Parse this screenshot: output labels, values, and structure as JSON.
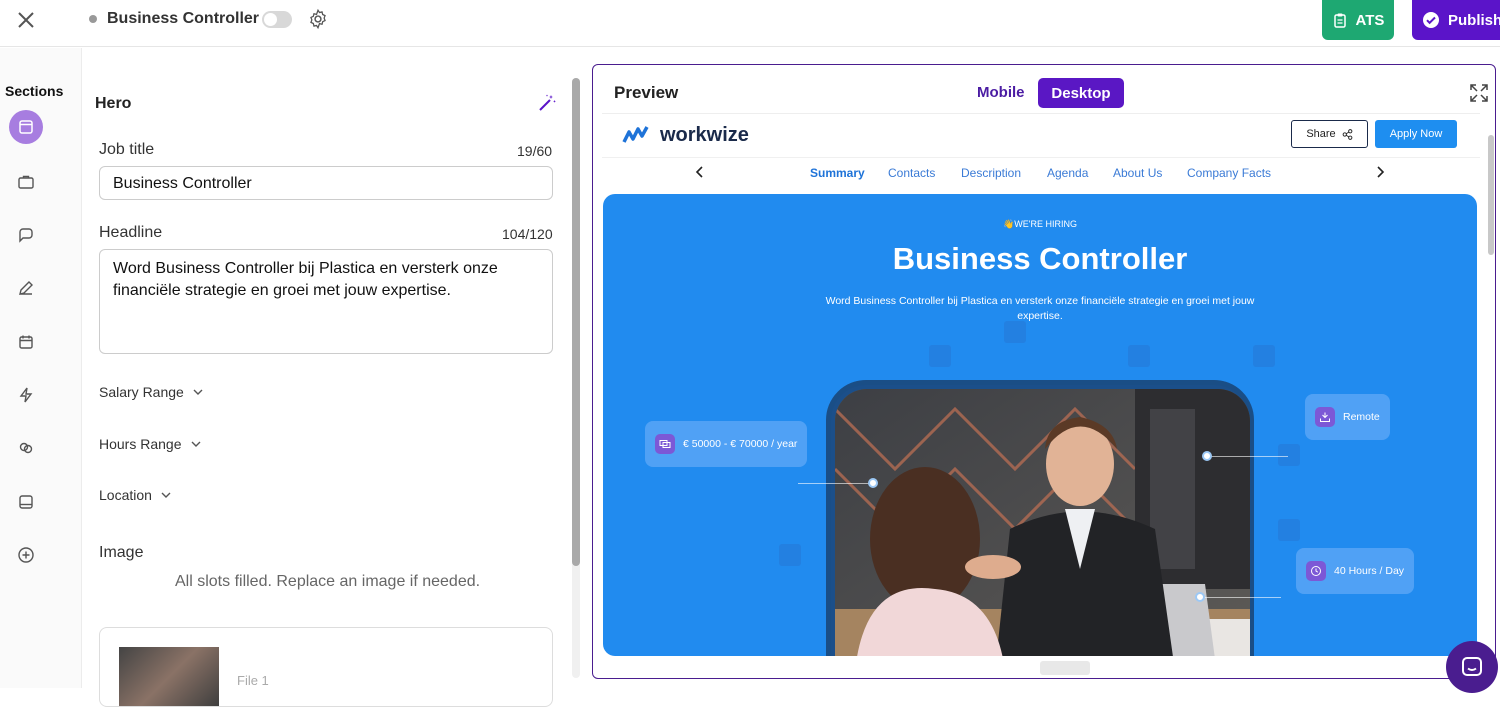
{
  "topbar": {
    "job_name": "Business Controller",
    "ats_label": "ATS",
    "publish_label": "Publish"
  },
  "sections": {
    "title": "Sections",
    "icons": [
      "hero-icon",
      "briefcase-icon",
      "chat-icon",
      "pencil-icon",
      "calendar-icon",
      "bolt-icon",
      "link-icon",
      "panel-icon",
      "add-icon"
    ]
  },
  "editor": {
    "section_title": "Hero",
    "job_title_label": "Job title",
    "job_title_counter": "19/60",
    "job_title_value": "Business Controller",
    "headline_label": "Headline",
    "headline_counter": "104/120",
    "headline_value": "Word Business Controller bij Plastica en versterk onze financiële strategie en groei met jouw expertise.",
    "salary_range_label": "Salary Range",
    "hours_range_label": "Hours Range",
    "location_label": "Location",
    "image_label": "Image",
    "image_hint": "All slots filled. Replace an image if needed.",
    "file_label": "File 1"
  },
  "preview": {
    "title": "Preview",
    "tab_mobile": "Mobile",
    "tab_desktop": "Desktop",
    "site": {
      "logo_text": "workwize",
      "share_label": "Share",
      "apply_label": "Apply Now",
      "nav": [
        "Summary",
        "Contacts",
        "Description",
        "Agenda",
        "About Us",
        "Company Facts"
      ],
      "hiring_badge": "👋WE'RE HIRING",
      "hero_title": "Business Controller",
      "hero_subtitle": "Word Business Controller bij Plastica en versterk onze financiële strategie en groei met jouw expertise.",
      "chip_salary": "€ 50000 - € 70000 / year",
      "chip_remote": "Remote",
      "chip_hours": "40 Hours / Day"
    }
  },
  "colors": {
    "ats": "#1ea872",
    "publish": "#5b14c9",
    "accent": "#5a17c4",
    "hero_bg": "#218bef"
  }
}
